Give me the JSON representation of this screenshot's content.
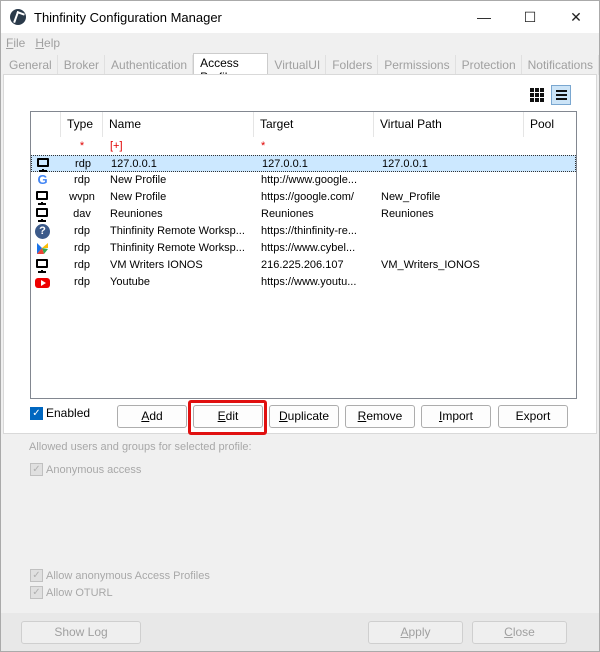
{
  "window": {
    "title": "Thinfinity Configuration Manager",
    "buttons": [
      "—",
      "☐",
      "✕"
    ]
  },
  "menu": [
    {
      "label": "File",
      "accel": "F",
      "rest": "ile"
    },
    {
      "label": "Help",
      "accel": "H",
      "rest": "elp"
    }
  ],
  "tabs": [
    "General",
    "Broker",
    "Authentication",
    "Access Profiles",
    "VirtualUI",
    "Folders",
    "Permissions",
    "Protection",
    "Notifications"
  ],
  "active_tab": "Access Profiles",
  "list": {
    "columns": [
      "",
      "Type",
      "Name",
      "Target",
      "Virtual Path",
      "Pool"
    ],
    "rows": [
      {
        "icon": "none",
        "type": "*",
        "name": "[+]",
        "target": "*",
        "vpath": "",
        "pool": "",
        "new": true
      },
      {
        "icon": "monitor-icon",
        "type": "rdp",
        "name": "127.0.0.1",
        "target": "127.0.0.1",
        "vpath": "127.0.0.1",
        "pool": "",
        "selected": true
      },
      {
        "icon": "google-icon",
        "type": "rdp",
        "name": "New Profile",
        "target": "http://www.google...",
        "vpath": "",
        "pool": ""
      },
      {
        "icon": "monitor-icon",
        "type": "wvpn",
        "name": "New Profile",
        "target": "https://google.com/",
        "vpath": "New_Profile",
        "pool": ""
      },
      {
        "icon": "monitor-icon",
        "type": "dav",
        "name": "Reuniones",
        "target": "Reuniones",
        "vpath": "Reuniones",
        "pool": ""
      },
      {
        "icon": "help-icon",
        "type": "rdp",
        "name": "Thinfinity Remote Worksp...",
        "target": "https://thinfinity-re...",
        "vpath": "",
        "pool": ""
      },
      {
        "icon": "cybele-icon",
        "type": "rdp",
        "name": "Thinfinity Remote Worksp...",
        "target": "https://www.cybel...",
        "vpath": "",
        "pool": ""
      },
      {
        "icon": "monitor-icon",
        "type": "rdp",
        "name": "VM Writers IONOS",
        "target": "216.225.206.107",
        "vpath": "VM_Writers_IONOS",
        "pool": ""
      },
      {
        "icon": "youtube-icon",
        "type": "rdp",
        "name": "Youtube",
        "target": "https://www.youtu...",
        "vpath": "",
        "pool": ""
      }
    ]
  },
  "enabled": {
    "label": "Enabled",
    "checked": true
  },
  "buttons": {
    "add": {
      "label": "Add",
      "accel": "A",
      "rest": "dd"
    },
    "edit": {
      "label": "Edit",
      "accel": "E",
      "rest": "dit"
    },
    "duplicate": {
      "label": "Duplicate",
      "accel": "D",
      "rest": "uplicate"
    },
    "remove": {
      "label": "Remove",
      "accel": "R",
      "rest": "emove"
    },
    "import": {
      "label": "Import",
      "accel": "I",
      "rest": "mport"
    },
    "export": {
      "label": "Export",
      "accel": "E",
      "rest": "xport"
    }
  },
  "allowed_section": {
    "label": "Allowed users and groups for selected  profile:"
  },
  "anonymous_access": {
    "label": "Anonymous access",
    "checked": true
  },
  "allow_anon_profiles": {
    "label": "Allow anonymous Access Profiles",
    "checked": true
  },
  "allow_oturl": {
    "label": "Allow OTURL",
    "checked": true
  },
  "footer": {
    "show_log": {
      "label": "Show Log"
    },
    "apply": {
      "label": "Apply",
      "accel": "A",
      "rest": "pply"
    },
    "close": {
      "label": "Close",
      "accel": "C",
      "rest": "lose"
    }
  },
  "colors": {
    "highlight": "#e01010",
    "selection": "#cce8ff",
    "accent": "#0067c0"
  }
}
